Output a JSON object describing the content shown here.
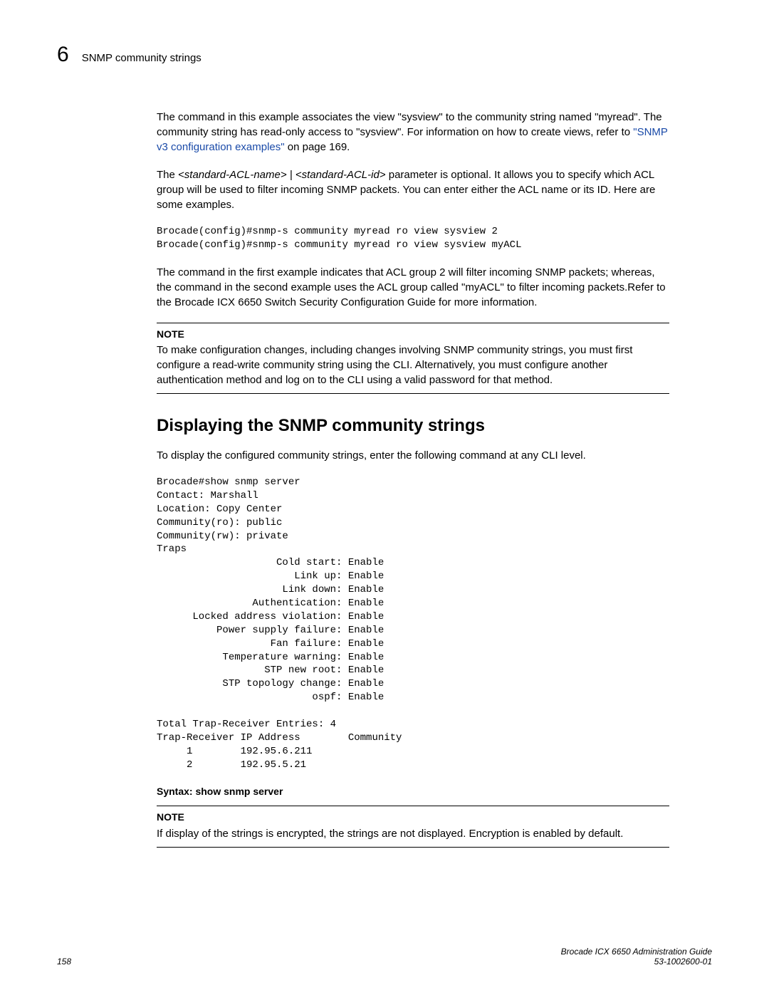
{
  "header": {
    "chapter": "6",
    "title": "SNMP community strings"
  },
  "body": {
    "p1a": "The command in this example associates the view \"sysview\" to the community string named \"myread\". The community string has read-only access to \"sysview\".  For information on how to create views, refer to ",
    "p1link": "\"SNMP v3 configuration examples\"",
    "p1b": " on page 169.",
    "p2a": "The ",
    "p2i": "<standard-ACL-name> | <standard-ACL-id>",
    "p2b": " parameter  is optional.  It allows you to specify which ACL group will be used to filter incoming SNMP packets. You can enter either the ACL name or its ID.  Here are some examples.",
    "code1": "Brocade(config)#snmp-s community myread ro view sysview 2\nBrocade(config)#snmp-s community myread ro view sysview myACL",
    "p3": "The command in the first example indicates that ACL group 2 will filter incoming SNMP packets; whereas, the command in the second example uses the ACL group called \"myACL\" to filter incoming packets.Refer to the Brocade ICX 6650 Switch Security Configuration Guide for more information.",
    "note1label": "NOTE",
    "note1": "To make configuration changes, including changes involving SNMP community strings, you must first configure a read-write community string using the CLI.  Alternatively, you must configure another authentication method and log on to the CLI using a valid password for that method.",
    "sectionTitle": "Displaying the SNMP community strings",
    "p4": "To display the configured community strings, enter the following command at any CLI level.",
    "code2": "Brocade#show snmp server\nContact: Marshall\nLocation: Copy Center\nCommunity(ro): public\nCommunity(rw): private\nTraps\n                    Cold start: Enable\n                       Link up: Enable\n                     Link down: Enable\n                Authentication: Enable\n      Locked address violation: Enable\n          Power supply failure: Enable\n                   Fan failure: Enable\n           Temperature warning: Enable\n                  STP new root: Enable\n           STP topology change: Enable\n                          ospf: Enable\n\nTotal Trap-Receiver Entries: 4\nTrap-Receiver IP Address        Community\n     1        192.95.6.211\n     2        192.95.5.21",
    "syntax": "Syntax:  show snmp server",
    "note2label": "NOTE",
    "note2": "If display of the strings is encrypted, the strings are not displayed.  Encryption is enabled by default."
  },
  "footer": {
    "page": "158",
    "docTitle": "Brocade ICX 6650 Administration Guide",
    "docNum": "53-1002600-01"
  }
}
